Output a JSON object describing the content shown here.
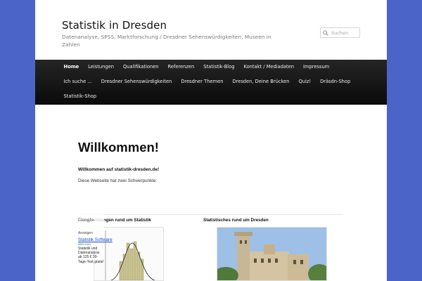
{
  "site": {
    "title": "Statistik in Dresden",
    "description": "Datenanalyse, SPSS, Marktforschung / Dresdner Sehenswürdigkeiten, Museen in Zahlen"
  },
  "search": {
    "placeholder": "Suchen"
  },
  "nav": {
    "row1": [
      "Home",
      "Leistungen",
      "Qualifikationen",
      "Referenzen",
      "Statistik-Blog",
      "Kontakt / Mediadaten",
      "Impressum"
    ],
    "row2": [
      "Ich suche ...",
      "Dresdner Sehenswürdigkeiten",
      "Dresdner Themen",
      "Dresden, Deine Brücken",
      "Quiz!",
      "Dräsdn-Shop"
    ],
    "row3": [
      "Statistik-Shop"
    ],
    "active": "Home"
  },
  "content": {
    "heading": "Willkommen!",
    "welcome": "Willkommen auf statistik-dresden.de!",
    "intro": "Diese Webseite hat zwei Schwerpunkte:",
    "col_left_title": "Dienstleistungen rund um Statistik",
    "col_right_title": "Statistisches rund um Dresden"
  },
  "ad": {
    "google": "Google",
    "label": "-Anzeigen",
    "title": "Statistik Software",
    "url": "vkter.com",
    "text": "Statistik und Datenanalyse ab 125 € 30-Tage-Test gratis!"
  },
  "colors": {
    "background": "#4a64c8",
    "nav": "#111111",
    "histogram": "#c9c28a",
    "sky": "#9ec0e6"
  }
}
